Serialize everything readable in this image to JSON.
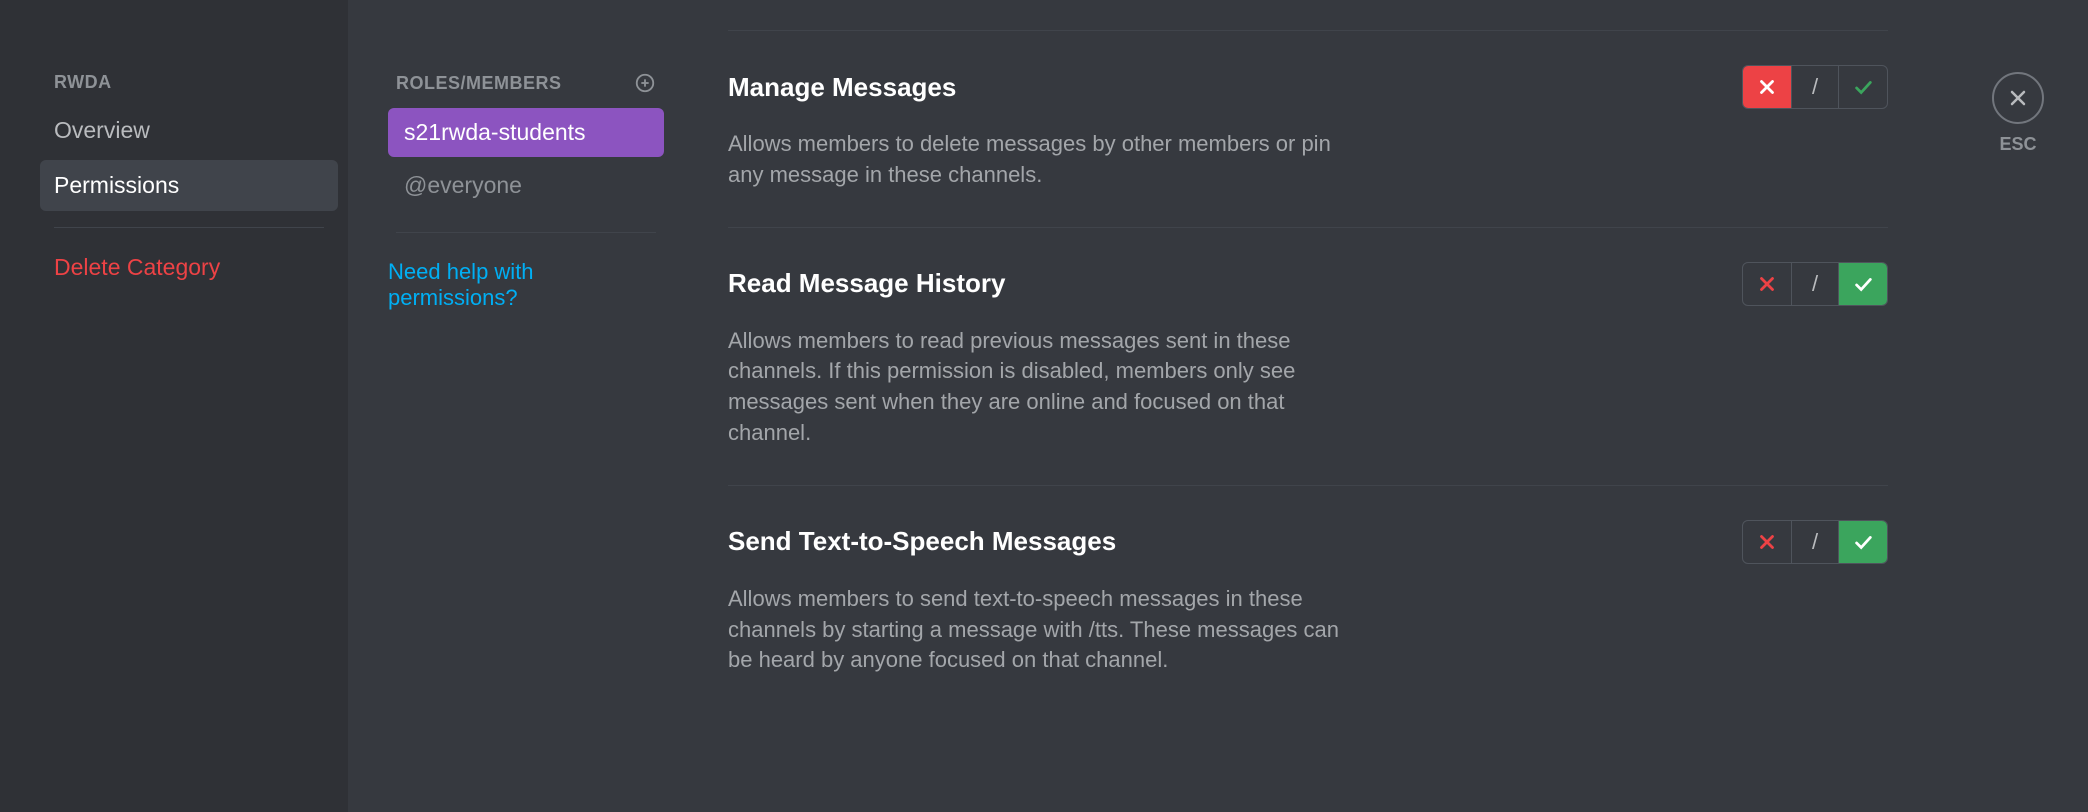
{
  "sidebar": {
    "header": "RWDA",
    "items": [
      {
        "label": "Overview",
        "active": false
      },
      {
        "label": "Permissions",
        "active": true
      }
    ],
    "delete_label": "Delete Category"
  },
  "roles": {
    "header": "ROLES/MEMBERS",
    "items": [
      {
        "label": "s21rwda-students",
        "selected": true
      },
      {
        "label": "@everyone",
        "selected": false
      }
    ],
    "help_label": "Need help with permissions?"
  },
  "permissions": [
    {
      "title": "Manage Messages",
      "description": "Allows members to delete messages by other members or pin any message in these channels.",
      "state": "deny"
    },
    {
      "title": "Read Message History",
      "description": "Allows members to read previous messages sent in these channels. If this permission is disabled, members only see messages sent when they are online and focused on that channel.",
      "state": "allow"
    },
    {
      "title": "Send Text-to-Speech Messages",
      "description": "Allows members to send text-to-speech messages in these channels by starting a message with /tts. These messages can be heard by anyone focused on that channel.",
      "state": "allow"
    }
  ],
  "close": {
    "esc_label": "ESC"
  },
  "toggle_pass_glyph": "/"
}
